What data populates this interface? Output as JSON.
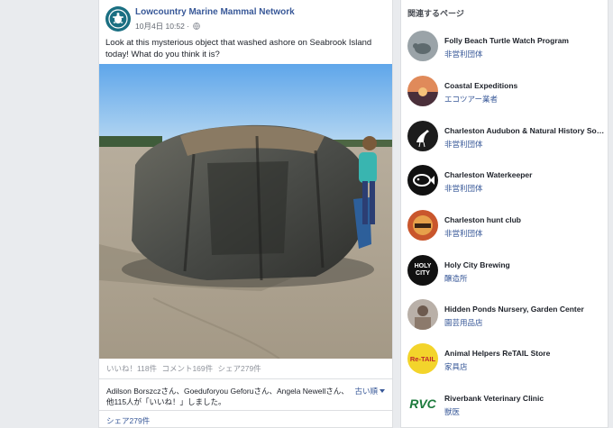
{
  "post": {
    "page_name": "Lowcountry Marine Mammal Network",
    "date": "10月4日 10:52 ·",
    "text": "Look at this mysterious object that washed ashore on Seabrook Island today! What do you think it is?",
    "likes": "いいね！118件",
    "comments": "コメント169件",
    "shares_stat": "シェア279件",
    "likers_text": "Adilson Borszczさん、Goeduforyou Geforuさん、Angela Newellさん、他115人が「いいね！」しました。",
    "sort_label": "古い順",
    "shares_link": "シェア279件"
  },
  "sidebar": {
    "title": "関連するページ",
    "pages": [
      {
        "name": "Folly Beach Turtle Watch Program",
        "category": "非営利団体"
      },
      {
        "name": "Coastal Expeditions",
        "category": "エコツアー業者"
      },
      {
        "name": "Charleston Audubon & Natural History Society",
        "category": "非営利団体"
      },
      {
        "name": "Charleston Waterkeeper",
        "category": "非営利団体"
      },
      {
        "name": "Charleston hunt club",
        "category": "非営利団体"
      },
      {
        "name": "Holy City Brewing",
        "category": "醸造所"
      },
      {
        "name": "Hidden Ponds Nursery, Garden Center",
        "category": "園芸用品店"
      },
      {
        "name": "Animal Helpers ReTAIL Store",
        "category": "家具店"
      },
      {
        "name": "Riverbank Veterinary Clinic",
        "category": "獣医"
      }
    ],
    "avatar_texts": {
      "holy_city": "HOLY CITY",
      "retail": "Re-TAIL",
      "rvc": "RVC"
    }
  },
  "colors": {
    "link": "#385898",
    "background": "#e9ebee",
    "page_avatar": "#1a6f82"
  },
  "icons": [
    "globe-icon",
    "turtle-icon",
    "bird-icon",
    "fish-icon",
    "caret-down-icon"
  ]
}
